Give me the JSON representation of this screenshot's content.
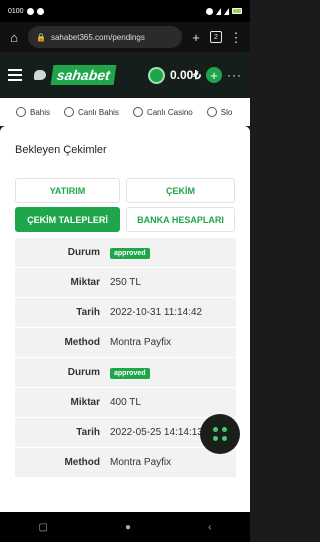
{
  "status_bar": {
    "time": "0100"
  },
  "browser": {
    "url": "sahabet365.com/pendings",
    "tab_count": "2"
  },
  "site_header": {
    "logo_text": "sahabet",
    "balance": "0.00₺",
    "plus_label": "+",
    "more_label": "···"
  },
  "nav": {
    "items": [
      {
        "label": "Bahis"
      },
      {
        "label": "Canlı Bahis"
      },
      {
        "label": "Canlı Casino"
      },
      {
        "label": "Slo"
      }
    ]
  },
  "page": {
    "title": "Bekleyen Çekimler",
    "tabs": {
      "deposit": "YATIRIM",
      "withdraw": "ÇEKİM",
      "withdraw_requests": "ÇEKİM TALEPLERİ",
      "bank_accounts": "BANKA HESAPLARI"
    },
    "labels": {
      "status": "Durum",
      "amount": "Miktar",
      "date": "Tarih",
      "method": "Method"
    },
    "records": [
      {
        "status": "approved",
        "amount": "250 TL",
        "date": "2022-10-31 11:14:42",
        "method": "Montra Payfix"
      },
      {
        "status": "approved",
        "amount": "400 TL",
        "date": "2022-05-25 14:14:13",
        "method": "Montra Payfix"
      }
    ]
  },
  "colors": {
    "accent": "#1fa64a",
    "header_bg": "#151e1a",
    "row_bg": "#f2f2f2"
  }
}
